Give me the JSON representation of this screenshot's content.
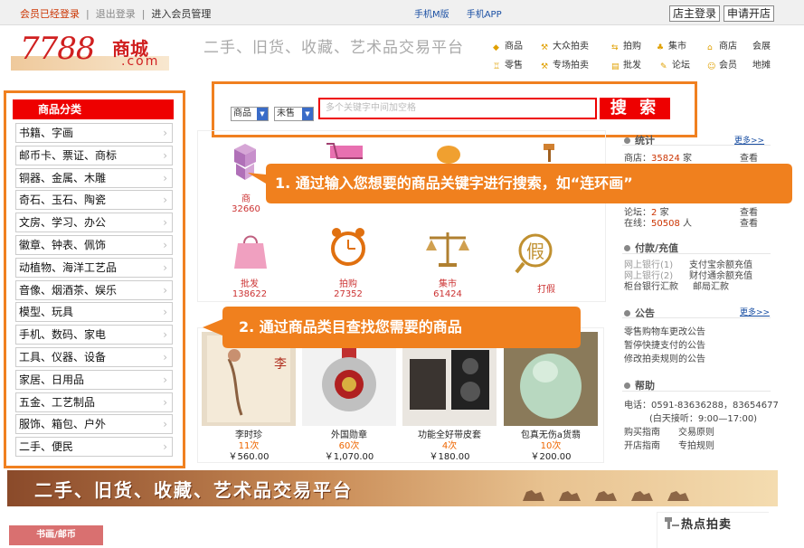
{
  "topbar": {
    "logged_in": "会员已经登录",
    "logout": "退出登录",
    "member_mgmt": "进入会员管理",
    "mobile_web": "手机M版",
    "mobile_app": "手机APP",
    "shop_login": "店主登录",
    "apply_shop": "申请开店"
  },
  "logo": {
    "number": "7788",
    "name": "商城",
    "domain": ".com"
  },
  "slogan": "二手、旧货、收藏、艺术品交易平台",
  "nav": {
    "row1": [
      "商品",
      "大众拍卖",
      "拍购",
      "集市",
      "商店",
      "会展"
    ],
    "row2": [
      "零售",
      "专场拍卖",
      "批发",
      "论坛",
      "会员",
      "地摊"
    ]
  },
  "category": {
    "title": "商品分类",
    "items": [
      "书籍、字画",
      "邮币卡、票证、商标",
      "铜器、金属、木雕",
      "奇石、玉石、陶瓷",
      "文房、学习、办公",
      "徽章、钟表、佩饰",
      "动植物、海洋工艺品",
      "音像、烟酒茶、娱乐",
      "模型、玩具",
      "手机、数码、家电",
      "工具、仪器、设备",
      "家居、日用品",
      "五金、工艺制品",
      "服饰、箱包、户外",
      "二手、便民"
    ]
  },
  "search": {
    "type_select": "商品",
    "status_select": "未售",
    "placeholder": "多个关键字中间加空格",
    "button": "搜 索"
  },
  "grid": {
    "top": [
      {
        "name": "商",
        "count": "32660"
      },
      {
        "name": "",
        "count": ""
      },
      {
        "name": "",
        "count": ""
      },
      {
        "name": "",
        "count": ""
      }
    ],
    "bottom": [
      {
        "name": "批发",
        "count": "138622"
      },
      {
        "name": "拍购",
        "count": "27352"
      },
      {
        "name": "集市",
        "count": "61424"
      },
      {
        "name": "打假",
        "count": ""
      }
    ]
  },
  "callouts": {
    "first": "1. 通过输入您想要的商品关键字进行搜索，如“连环画”",
    "second": "2. 通过商品类目查找您需要的商品"
  },
  "products": [
    {
      "name": "李时珍",
      "count": "11次",
      "price": "￥560.00"
    },
    {
      "name": "外国勋章",
      "count": "60次",
      "price": "￥1,070.00"
    },
    {
      "name": "功能全好带皮套",
      "count": "4次",
      "price": "￥180.00"
    },
    {
      "name": "包真无伤a货翡",
      "count": "10次",
      "price": "￥200.00"
    }
  ],
  "stats": {
    "title": "统计",
    "more": "更多>>",
    "shop_label": "商店：",
    "shop_count": "35824",
    "shop_unit": "家",
    "view1": "查看",
    "other_label": "论坛：",
    "other_count": "2",
    "other_unit": "家",
    "view2": "查看",
    "online_label": "在线：",
    "online_count": "50508",
    "online_unit": "人",
    "view3": "查看"
  },
  "payment": {
    "title": "付款/充值",
    "bank1": "网上银行(1)",
    "recharge1": "支付宝余额充值",
    "bank2": "网上银行(2)",
    "recharge2": "财付通余额充值",
    "bank3": "柜台银行汇款",
    "postal": "邮局汇款"
  },
  "notice": {
    "title": "公告",
    "more": "更多>>",
    "items": [
      "零售购物车更改公告",
      "暂停快捷支付的公告",
      "修改拍卖规则的公告"
    ]
  },
  "help": {
    "title": "帮助",
    "phone": "电话：0591-83636288，83654677",
    "hours": "(白天接听：9:00—17:00)",
    "links": [
      "购买指南",
      "交易原则",
      "开店指南",
      "专拍规则"
    ]
  },
  "banner": {
    "text": "二手、旧货、收藏、艺术品交易平台"
  },
  "section_tab": "书画/邮币",
  "hot_auction": "热点拍卖",
  "colors": {
    "accent": "#f0801e",
    "brand_red": "#e00000",
    "link_blue": "#1a4fa3"
  }
}
